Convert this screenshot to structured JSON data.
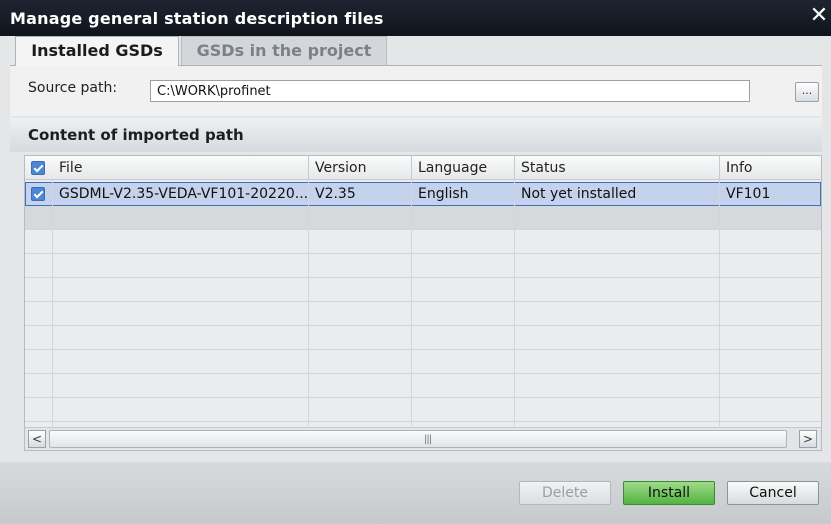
{
  "window": {
    "title": "Manage general station description files",
    "close_glyph": "✕"
  },
  "tabs": [
    {
      "label": "Installed GSDs",
      "active": true
    },
    {
      "label": "GSDs in the project",
      "active": false
    }
  ],
  "source": {
    "label": "Source path:",
    "value": "C:\\WORK\\profinet",
    "browse_label": "..."
  },
  "content": {
    "title": "Content of imported path",
    "columns": [
      "File",
      "Version",
      "Language",
      "Status",
      "Info"
    ],
    "rows": [
      {
        "checked": true,
        "file": "GSDML-V2.35-VEDA-VF101-20220...",
        "version": "V2.35",
        "language": "English",
        "status": "Not yet installed",
        "info": "VF101"
      }
    ]
  },
  "scrollbar": {
    "left_glyph": "<",
    "right_glyph": ">",
    "grip_glyph": "|||"
  },
  "buttons": {
    "delete": "Delete",
    "install": "Install",
    "cancel": "Cancel"
  },
  "colors": {
    "title_bar": "#0f141c",
    "selected_row": "#c4d3eb",
    "install_button": "#52b340",
    "checkbox": "#4c86d6"
  }
}
